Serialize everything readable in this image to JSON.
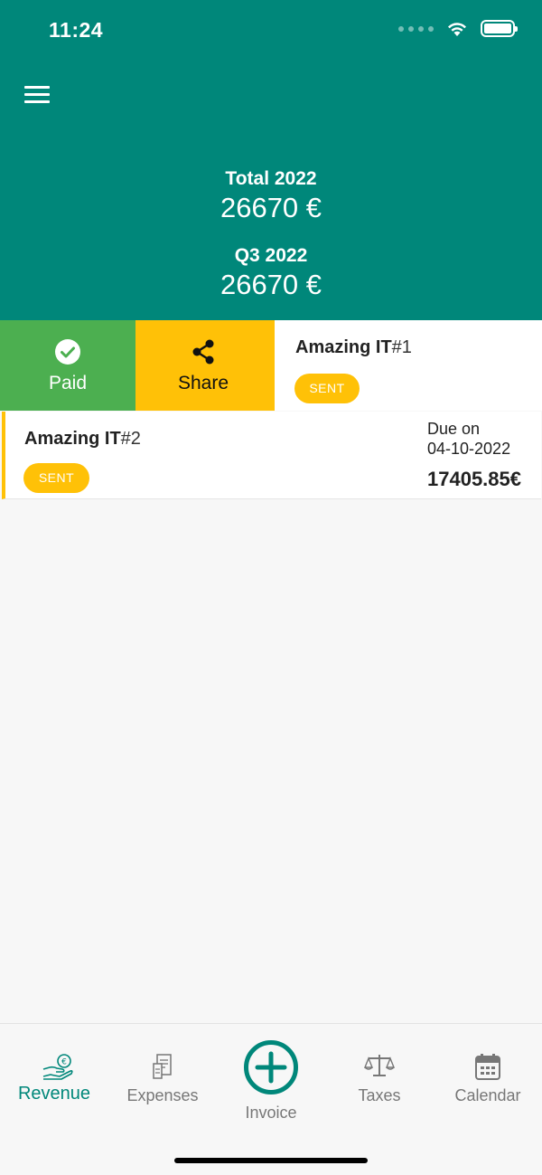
{
  "status": {
    "time": "11:24"
  },
  "header": {
    "menu_icon": "hamburger-menu-icon",
    "total_label": "Total 2022",
    "total_amount": "26670 €",
    "quarter_label": "Q3 2022",
    "quarter_amount": "26670 €",
    "color": "#00877a"
  },
  "actions": {
    "paid_label": "Paid",
    "paid_icon": "check-circle-icon",
    "paid_color": "#4caf50",
    "share_label": "Share",
    "share_icon": "share-icon",
    "share_color": "#ffc107"
  },
  "invoices": [
    {
      "client": "Amazing IT",
      "number": "#1",
      "status": "SENT"
    },
    {
      "client": "Amazing IT",
      "number": "#2",
      "status": "SENT",
      "due_label": "Due on",
      "due_date": "04-10-2022",
      "amount": "17405.85€"
    }
  ],
  "tabs": [
    {
      "label": "Revenue",
      "icon": "revenue-hand-euro-icon",
      "active": true
    },
    {
      "label": "Expenses",
      "icon": "expenses-receipt-icon",
      "active": false
    },
    {
      "label": "Invoice",
      "icon": "add-circle-icon",
      "active": false
    },
    {
      "label": "Taxes",
      "icon": "scales-icon",
      "active": false
    },
    {
      "label": "Calendar",
      "icon": "calendar-icon",
      "active": false
    }
  ]
}
